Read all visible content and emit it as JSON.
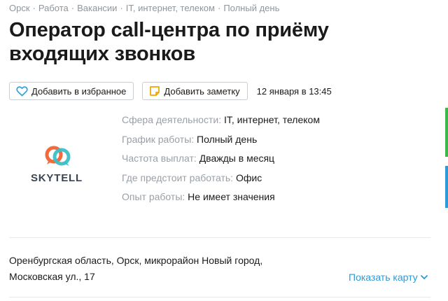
{
  "breadcrumb": {
    "items": [
      "Орск",
      "Работа",
      "Вакансии",
      "IT, интернет, телеком",
      "Полный день"
    ],
    "separator": "·"
  },
  "vacancy": {
    "title": "Оператор call-центра по приёму входящих звонков"
  },
  "actions": {
    "favorite_label": "Добавить в избранное",
    "note_label": "Добавить заметку",
    "date": "12 января в 13:45"
  },
  "company": {
    "logo_text": "SKYTELL",
    "logo_colors": {
      "orange": "#f26a3d",
      "teal": "#3bbfc7"
    }
  },
  "properties": [
    {
      "key": "Сфера деятельности:",
      "value": "IT, интернет, телеком"
    },
    {
      "key": "График работы:",
      "value": "Полный день"
    },
    {
      "key": "Частота выплат:",
      "value": "Дважды в месяц"
    },
    {
      "key": "Где предстоит работать:",
      "value": "Офис"
    },
    {
      "key": "Опыт работы:",
      "value": "Не имеет значения"
    }
  ],
  "location": {
    "address_line1": "Оренбургская область, Орск, микрорайон Новый город,",
    "address_line2": "Московская ул., 17",
    "show_map_label": "Показать карту"
  },
  "colors": {
    "link": "#2a9bd8",
    "muted": "#9aa0a6",
    "border": "#c9ced3"
  }
}
